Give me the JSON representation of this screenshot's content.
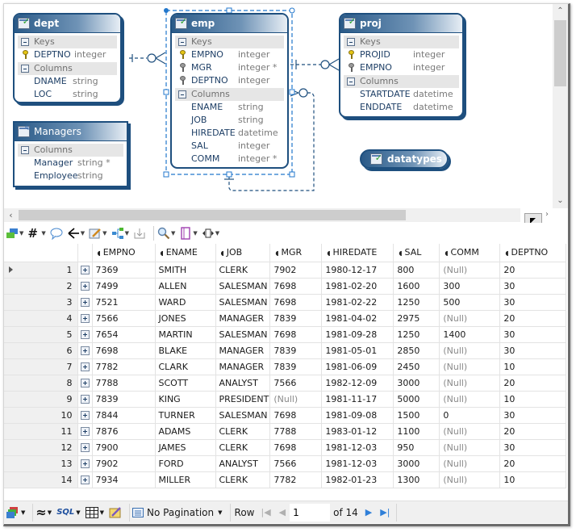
{
  "diagram": {
    "entities": {
      "dept": {
        "title": "dept",
        "keys_label": "Keys",
        "columns_label": "Columns",
        "keys": [
          {
            "name": "DEPTNO",
            "type": "integer",
            "key": "primary"
          }
        ],
        "columns": [
          {
            "name": "DNAME",
            "type": "string"
          },
          {
            "name": "LOC",
            "type": "string"
          }
        ]
      },
      "emp": {
        "title": "emp",
        "keys_label": "Keys",
        "columns_label": "Columns",
        "keys": [
          {
            "name": "EMPNO",
            "type": "integer",
            "key": "primary"
          },
          {
            "name": "MGR",
            "type": "integer *",
            "key": "foreign"
          },
          {
            "name": "DEPTNO",
            "type": "integer",
            "key": "foreign"
          }
        ],
        "columns": [
          {
            "name": "ENAME",
            "type": "string"
          },
          {
            "name": "JOB",
            "type": "string"
          },
          {
            "name": "HIREDATE",
            "type": "datetime"
          },
          {
            "name": "SAL",
            "type": "integer"
          },
          {
            "name": "COMM",
            "type": "integer *"
          }
        ]
      },
      "proj": {
        "title": "proj",
        "keys_label": "Keys",
        "columns_label": "Columns",
        "keys": [
          {
            "name": "PROJID",
            "type": "integer",
            "key": "primary"
          },
          {
            "name": "EMPNO",
            "type": "integer",
            "key": "foreign"
          }
        ],
        "columns": [
          {
            "name": "STARTDATE",
            "type": "datetime"
          },
          {
            "name": "ENDDATE",
            "type": "datetime"
          }
        ]
      },
      "managers": {
        "title": "Managers",
        "columns_label": "Columns",
        "columns": [
          {
            "name": "Manager",
            "type": "string *"
          },
          {
            "name": "Employee",
            "type": "string"
          }
        ]
      },
      "datatypes": {
        "title": "datatypes"
      }
    }
  },
  "toolbar": {
    "icons": [
      "layers-icon",
      "hash-icon",
      "comment-icon",
      "relation-icon",
      "edit-icon",
      "layout-icon",
      "export-icon",
      "zoom-icon",
      "page-icon",
      "resize-icon"
    ]
  },
  "grid": {
    "columns": [
      "EMPNO",
      "ENAME",
      "JOB",
      "MGR",
      "HIREDATE",
      "SAL",
      "COMM",
      "DEPTNO"
    ],
    "current_row": 1,
    "rows": [
      {
        "n": "1",
        "cells": [
          "7369",
          "SMITH",
          "CLERK",
          "7902",
          "1980-12-17",
          "800",
          "(Null)",
          "20"
        ]
      },
      {
        "n": "2",
        "cells": [
          "7499",
          "ALLEN",
          "SALESMAN",
          "7698",
          "1981-02-20",
          "1600",
          "300",
          "30"
        ]
      },
      {
        "n": "3",
        "cells": [
          "7521",
          "WARD",
          "SALESMAN",
          "7698",
          "1981-02-22",
          "1250",
          "500",
          "30"
        ]
      },
      {
        "n": "4",
        "cells": [
          "7566",
          "JONES",
          "MANAGER",
          "7839",
          "1981-04-02",
          "2975",
          "(Null)",
          "20"
        ]
      },
      {
        "n": "5",
        "cells": [
          "7654",
          "MARTIN",
          "SALESMAN",
          "7698",
          "1981-09-28",
          "1250",
          "1400",
          "30"
        ]
      },
      {
        "n": "6",
        "cells": [
          "7698",
          "BLAKE",
          "MANAGER",
          "7839",
          "1981-05-01",
          "2850",
          "(Null)",
          "30"
        ]
      },
      {
        "n": "7",
        "cells": [
          "7782",
          "CLARK",
          "MANAGER",
          "7839",
          "1981-06-09",
          "2450",
          "(Null)",
          "10"
        ]
      },
      {
        "n": "8",
        "cells": [
          "7788",
          "SCOTT",
          "ANALYST",
          "7566",
          "1982-12-09",
          "3000",
          "(Null)",
          "20"
        ]
      },
      {
        "n": "9",
        "cells": [
          "7839",
          "KING",
          "PRESIDENT",
          "(Null)",
          "1981-11-17",
          "5000",
          "(Null)",
          "10"
        ]
      },
      {
        "n": "10",
        "cells": [
          "7844",
          "TURNER",
          "SALESMAN",
          "7698",
          "1981-09-08",
          "1500",
          "0",
          "30"
        ]
      },
      {
        "n": "11",
        "cells": [
          "7876",
          "ADAMS",
          "CLERK",
          "7788",
          "1983-01-12",
          "1100",
          "(Null)",
          "20"
        ]
      },
      {
        "n": "12",
        "cells": [
          "7900",
          "JAMES",
          "CLERK",
          "7698",
          "1981-12-03",
          "950",
          "(Null)",
          "30"
        ]
      },
      {
        "n": "13",
        "cells": [
          "7902",
          "FORD",
          "ANALYST",
          "7566",
          "1981-12-03",
          "3000",
          "(Null)",
          "20"
        ]
      },
      {
        "n": "14",
        "cells": [
          "7934",
          "MILLER",
          "CLERK",
          "7782",
          "1982-01-23",
          "1300",
          "(Null)",
          "10"
        ]
      }
    ]
  },
  "bottombar": {
    "pagination_label": "No Pagination",
    "row_label": "Row",
    "row_value": "1",
    "of_label": "of 14"
  }
}
